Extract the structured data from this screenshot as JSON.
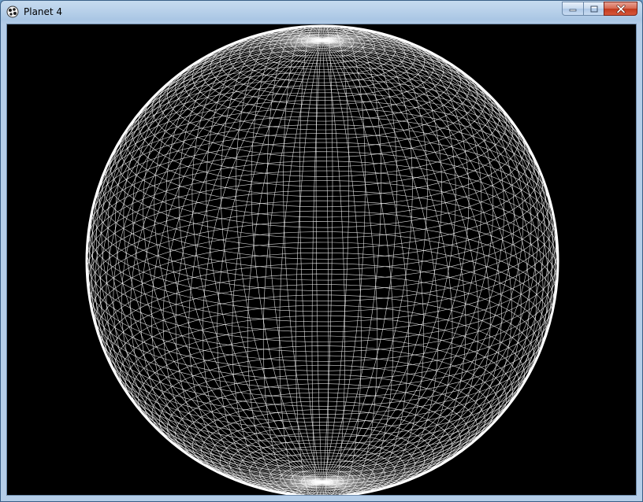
{
  "window": {
    "title": "Planet 4",
    "icons": {
      "app": "paint-palette-icon",
      "minimize": "minimize-icon",
      "maximize": "maximize-icon",
      "close": "close-icon"
    }
  },
  "canvas": {
    "background": "#000000",
    "sphere_color": "#ffffff",
    "style": "dense wireframe sphere"
  },
  "colors": {
    "titlebar": "#b9d1ea",
    "close_button": "#c23a1e"
  }
}
